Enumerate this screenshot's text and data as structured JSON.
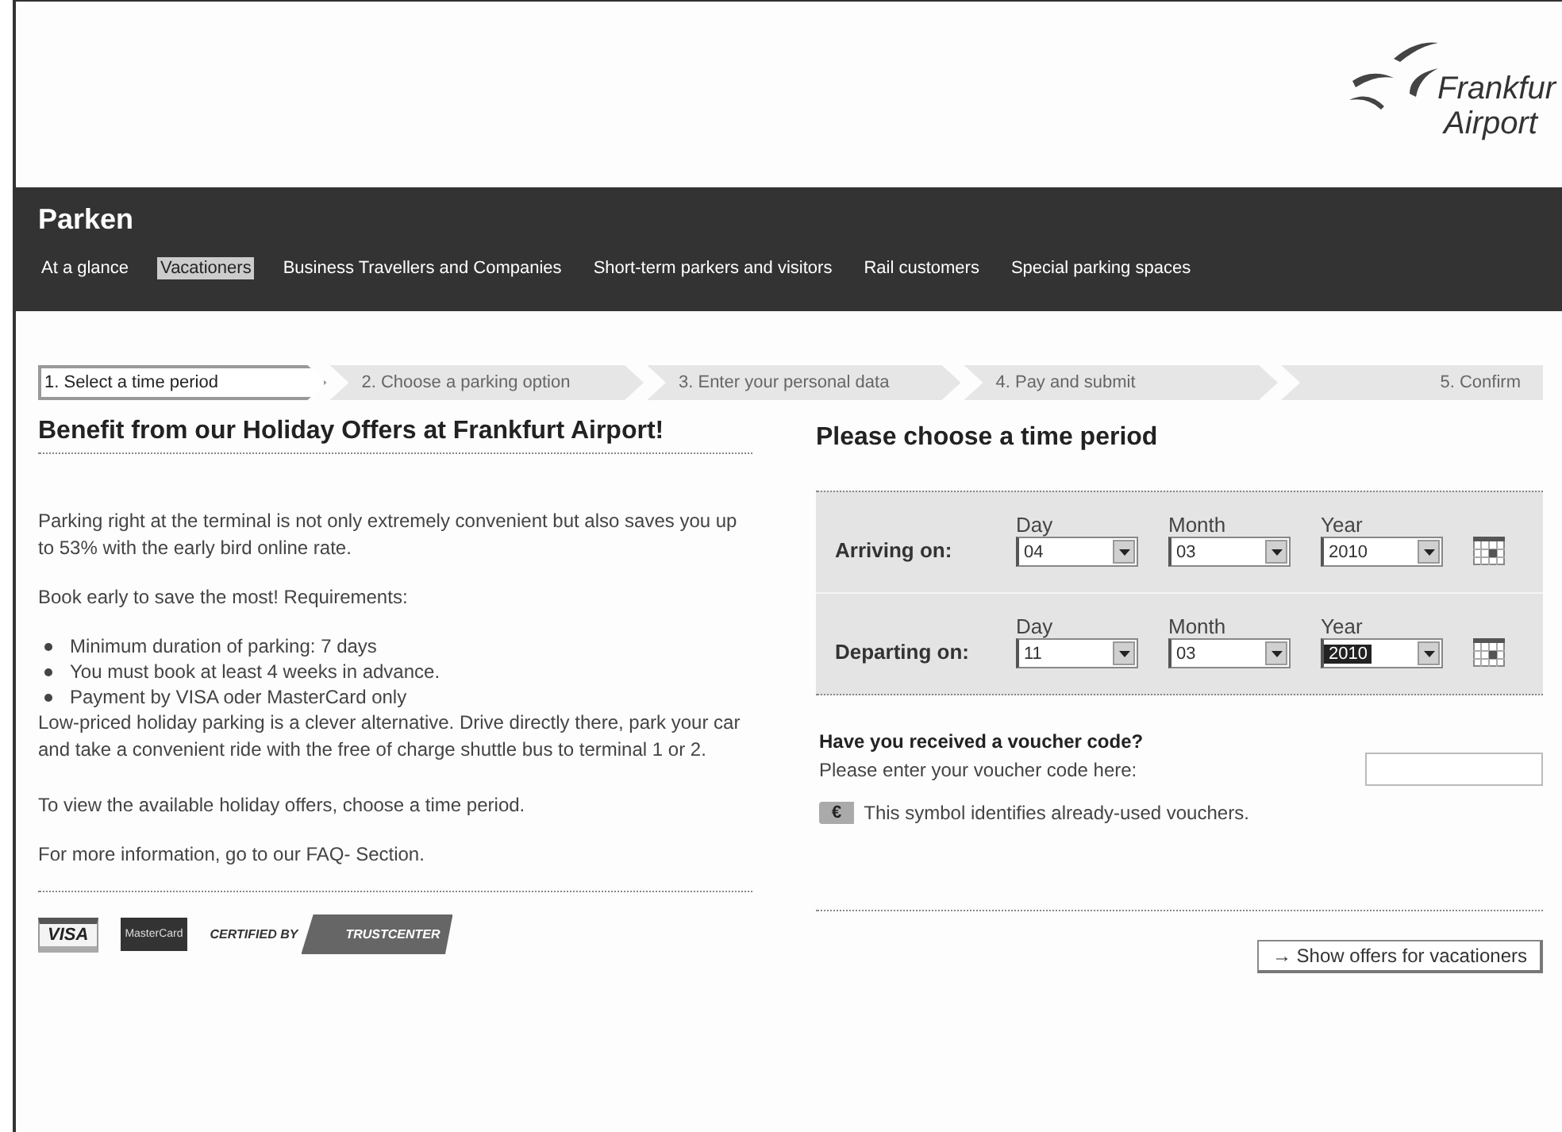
{
  "logo": {
    "line1": "Frankfur",
    "line2": "Airport"
  },
  "header": {
    "title": "Parken"
  },
  "nav": [
    {
      "label": "At a glance",
      "selected": false
    },
    {
      "label": "Vacationers",
      "selected": true
    },
    {
      "label": "Business Travellers and Companies",
      "selected": false
    },
    {
      "label": "Short-term parkers and visitors",
      "selected": false
    },
    {
      "label": "Rail customers",
      "selected": false
    },
    {
      "label": "Special parking spaces",
      "selected": false
    }
  ],
  "steps": [
    {
      "label": "1. Select a time period",
      "selected": true
    },
    {
      "label": "2. Choose a parking option",
      "selected": false
    },
    {
      "label": "3. Enter your personal data",
      "selected": false
    },
    {
      "label": "4. Pay and submit",
      "selected": false
    },
    {
      "label": "5. Confirm",
      "selected": false
    }
  ],
  "intro": {
    "heading": "Benefit from our Holiday Offers at Frankfurt Airport!",
    "paragraph_1": "Parking right at the terminal is not only extremely convenient but also saves you up to 53% with the early bird online rate.",
    "paragraph_2": "Book early to save the most! Requirements:",
    "requirements": [
      "Minimum duration of parking: 7 days",
      "You must book at least 4 weeks in advance.",
      "Payment by VISA oder MasterCard only"
    ],
    "paragraph_3": "Low-priced holiday parking is a clever alternative. Drive directly there, park your car and take a convenient ride with the free of charge shuttle bus to terminal 1 or 2.",
    "paragraph_4": "To view the available holiday offers, choose a time period.",
    "paragraph_5": "For more information, go to our FAQ- Section."
  },
  "payment_logos": {
    "visa": "VISA",
    "mastercard": "MasterCard",
    "certified_by": "CERTIFIED BY",
    "trustcenter": "TRUSTCENTER"
  },
  "period": {
    "heading": "Please choose a time period",
    "rows": [
      {
        "label": "Arriving on:",
        "fields": [
          {
            "caption": "Day",
            "value": "04",
            "selected": false
          },
          {
            "caption": "Month",
            "value": "03",
            "selected": false
          },
          {
            "caption": "Year",
            "value": "2010",
            "selected": false
          }
        ]
      },
      {
        "label": "Departing on:",
        "fields": [
          {
            "caption": "Day",
            "value": "11",
            "selected": false
          },
          {
            "caption": "Month",
            "value": "03",
            "selected": false
          },
          {
            "caption": "Year",
            "value": "2010",
            "selected": true
          }
        ]
      }
    ]
  },
  "voucher": {
    "heading": "Have you received a voucher code?",
    "prompt": "Please enter your voucher code here:",
    "symbol": "€",
    "note": "This symbol identifies already-used vouchers."
  },
  "submit_button": {
    "arrow": "→",
    "label": "Show offers for vacationers"
  }
}
